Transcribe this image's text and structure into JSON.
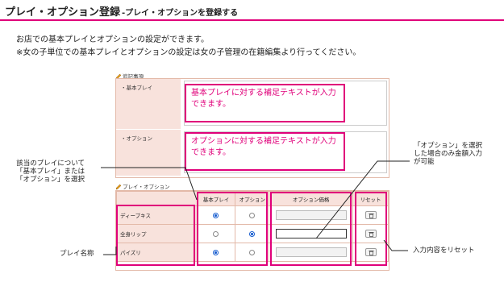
{
  "header": {
    "title": "プレイ・オプション登録",
    "subtitle": "-プレイ・オプションを登録する"
  },
  "intro": {
    "line1": "お店での基本プレイとオプションの設定ができます。",
    "line2": "※女の子単位での基本プレイとオプションの設定は女の子管理の在籍編集より行ってください。"
  },
  "notes_section": {
    "label": "追記事項",
    "rows": [
      {
        "label": "・基本プレイ",
        "hint": "基本プレイに対する補足テキストが入力できます。"
      },
      {
        "label": "・オプション",
        "hint": "オプションに対する補足テキストが入力できます。"
      }
    ]
  },
  "play_section": {
    "label": "プレイ・オプション",
    "columns": [
      "",
      "基本プレイ",
      "オプション",
      "オプション価格",
      "リセット"
    ],
    "rows": [
      {
        "name": "ディープキス",
        "selected": "basic"
      },
      {
        "name": "全身リップ",
        "selected": "option"
      },
      {
        "name": "パイズリ",
        "selected": "basic"
      }
    ]
  },
  "callouts": {
    "left_select": "該当のプレイについて\n「基本プレイ」または\n「オプション」を選択",
    "play_name": "プレイ名称",
    "option_price": "「オプション」を選択\nした場合のみ金額入力\nが可能",
    "reset": "入力内容をリセット"
  },
  "colors": {
    "accent": "#e0007a",
    "label_bg": "#f8e2dc",
    "border": "#e3b9a8",
    "radio": "#1a5fd0"
  },
  "icons": {
    "section": "pencil-icon",
    "reset": "trash-icon"
  }
}
